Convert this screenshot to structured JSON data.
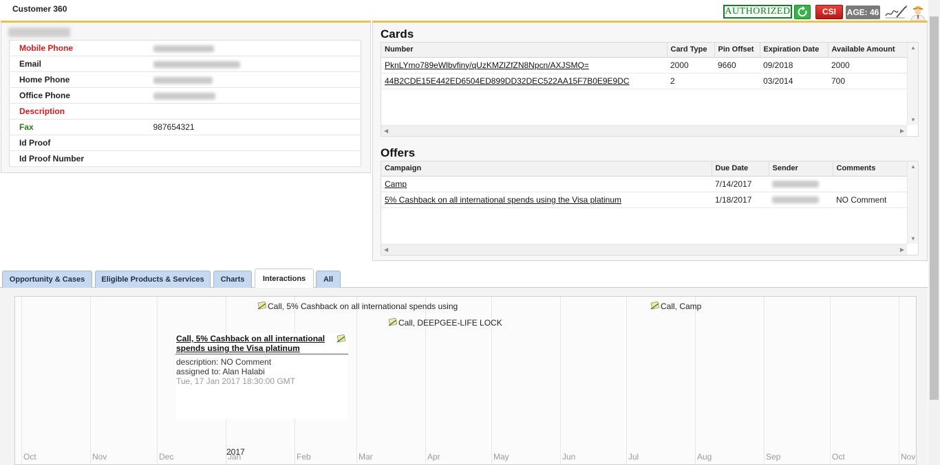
{
  "app": {
    "title": "Customer 360"
  },
  "header": {
    "authorized": "AUTHORIZED",
    "csi": "CSI",
    "age": "AGE: 46",
    "icons": [
      "refresh-icon",
      "signature-icon",
      "user-avatar-icon"
    ]
  },
  "contact": {
    "fields": [
      {
        "label": "Mobile Phone",
        "value": "",
        "color": "#d41a1a"
      },
      {
        "label": "Email",
        "value": "",
        "color": "#222222"
      },
      {
        "label": "Home Phone",
        "value": "",
        "color": "#222222"
      },
      {
        "label": "Office Phone",
        "value": "",
        "color": "#222222"
      },
      {
        "label": "Description",
        "value": "",
        "color": "#d41a1a"
      },
      {
        "label": "Fax",
        "value": "987654321",
        "color": "#2d7a1e"
      },
      {
        "label": "Id Proof",
        "value": "",
        "color": "#222222"
      },
      {
        "label": "Id Proof Number",
        "value": "",
        "color": "#222222"
      }
    ]
  },
  "cards": {
    "title": "Cards",
    "columns": [
      "Number",
      "Card Type",
      "Pin Offset",
      "Expiration Date",
      "Available Amount"
    ],
    "rows": [
      [
        "PknLYmo789eWlbvfiny/qUzKMZlZfZN8Npcn/AXJSMQ=",
        "2000",
        "9660",
        "09/2018",
        "2000"
      ],
      [
        "44B2CDE15E442ED6504ED899DD32DEC522AA15F7B0E9E9DC",
        "2",
        "",
        "03/2014",
        "700"
      ]
    ]
  },
  "offers": {
    "title": "Offers",
    "columns": [
      "Campaign",
      "Due Date",
      "Sender",
      "Comments"
    ],
    "rows": [
      [
        "Camp",
        "7/14/2017",
        "",
        ""
      ],
      [
        "5% Cashback on all international spends using the Visa platinum",
        "1/18/2017",
        "",
        "NO Comment"
      ]
    ]
  },
  "tabs": [
    {
      "label": "Opportunity & Cases",
      "active": false
    },
    {
      "label": "Eligible Products & Services",
      "active": false
    },
    {
      "label": "Charts",
      "active": false
    },
    {
      "label": "Interactions",
      "active": true
    },
    {
      "label": "All",
      "active": false
    }
  ],
  "timeline": {
    "months": [
      "Oct",
      "Nov",
      "Dec",
      "Jan",
      "Feb",
      "Mar",
      "Apr",
      "May",
      "Jun",
      "Jul",
      "Aug",
      "Sep",
      "Oct",
      "Nov"
    ],
    "year": "2017",
    "events": [
      "Call, 5% Cashback on all international spends using",
      "Call, Camp",
      "Call, DEEPGEE-LIFE LOCK"
    ],
    "popup": {
      "title": "Call, 5% Cashback on all international spends using the Visa platinum",
      "description": "description: NO Comment",
      "assigned": "assigned to: Alan Halabi",
      "date": "Tue, 17 Jan 2017 18:30:00 GMT"
    }
  }
}
